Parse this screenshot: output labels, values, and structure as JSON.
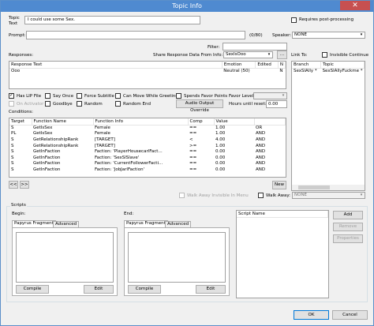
{
  "window": {
    "title": "Topic Info",
    "close_glyph": "✕"
  },
  "topic": {
    "topic_text_label": "Topic\nText",
    "topic_text_value": "I could use some Sex.",
    "requires_post_processing_label": "Requires post-processing",
    "prompt_label": "Prompt:",
    "prompt_value": "",
    "prompt_count": "(0/80)",
    "speaker_label": "Speaker:",
    "speaker_value": "NONE",
    "filter_label": "Filter:",
    "filter_value": ""
  },
  "responses": {
    "label": "Responses:",
    "share_label": "Share Response Data From Info:",
    "share_value": "SexIsOoo",
    "ellipsis_button": "...",
    "columns": [
      "Response Text",
      "Emotion",
      "Edited",
      "N"
    ],
    "rows": [
      {
        "text": "Ooo",
        "emotion": "Neutral (50)",
        "edited": "",
        "n": "N"
      }
    ]
  },
  "link_to": {
    "label": "Link To:",
    "invisible_continue_label": "Invisible Continue",
    "columns": [
      "Branch",
      "Topic"
    ],
    "rows": [
      {
        "branch": "SexSlAlly *",
        "topic": "SexSlAllyFuckme *"
      }
    ]
  },
  "options": {
    "has_lip_file": "Has LIP File",
    "say_once": "Say Once",
    "force_subtitle": "Force Subtitle",
    "can_move_while_greeting": "Can Move While Greeting",
    "spends_favor_points": "Spends Favor Points",
    "favor_level_label": "Favor Level:",
    "favor_level_value": "",
    "on_activator": "On Activator",
    "goodbye": "Goodbye",
    "random": "Random",
    "random_end": "Random End",
    "audio_output_override": "Audio Output Override",
    "hours_until_reset_label": "Hours until reset:",
    "hours_until_reset_value": "0.00"
  },
  "conditions": {
    "label": "Conditions:",
    "columns": [
      "Target",
      "Function Name",
      "Function Info",
      "Comp",
      "Value",
      ""
    ],
    "rows": [
      {
        "target": "S",
        "fn": "GetIsSex",
        "info": "Female",
        "comp": "==",
        "value": "1.00",
        "op": "OR"
      },
      {
        "target": "PL",
        "fn": "GetIsSex",
        "info": "Female",
        "comp": "==",
        "value": "1.00",
        "op": "AND"
      },
      {
        "target": "S",
        "fn": "GetRelationshipRank",
        "info": "[TARGET]",
        "comp": "<",
        "value": "4.00",
        "op": "AND"
      },
      {
        "target": "S",
        "fn": "GetRelationshipRank",
        "info": "[TARGET]",
        "comp": ">=",
        "value": "1.00",
        "op": "AND"
      },
      {
        "target": "S",
        "fn": "GetInFaction",
        "info": "Faction: 'PlayerHousecarlFact...",
        "comp": "==",
        "value": "0.00",
        "op": "AND"
      },
      {
        "target": "S",
        "fn": "GetInFaction",
        "info": "Faction: 'SexSlSlave'",
        "comp": "==",
        "value": "0.00",
        "op": "AND"
      },
      {
        "target": "S",
        "fn": "GetInFaction",
        "info": "Faction: 'CurrentFollowerFacti...",
        "comp": "==",
        "value": "0.00",
        "op": "AND"
      },
      {
        "target": "S",
        "fn": "GetInFaction",
        "info": "Faction: 'JobJarlFaction'",
        "comp": "==",
        "value": "0.00",
        "op": "AND"
      }
    ],
    "new_button": "New",
    "prev_button": "<<",
    "next_button": ">>",
    "walk_away_invisible_label": "Walk Away Invisible In Menu",
    "walk_away_label": "Walk Away:",
    "walk_away_value": "NONE"
  },
  "scripts": {
    "label": "Scripts",
    "begin_label": "Begin:",
    "end_label": "End:",
    "tab_papyrus": "Papyrus Fragment",
    "tab_advanced": "Advanced",
    "compile": "Compile",
    "edit": "Edit",
    "script_name_col": "Script Name",
    "add": "Add",
    "remove": "Remove",
    "properties": "Properties"
  },
  "footer": {
    "ok": "OK",
    "cancel": "Cancel"
  },
  "colors": {
    "titlebar": "#4f8ad0",
    "close": "#c75050",
    "selection": "#cce8ff"
  }
}
